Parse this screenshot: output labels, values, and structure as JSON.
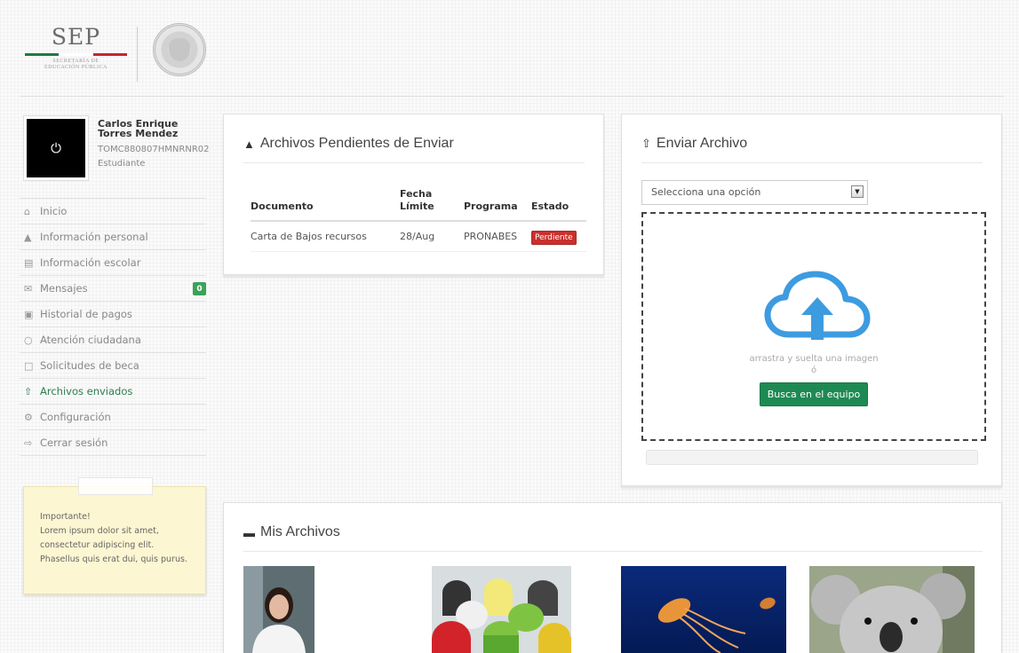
{
  "header": {
    "logo_text": "SEP",
    "logo_subtitle_1": "SECRETARÍA DE",
    "logo_subtitle_2": "EDUCACIÓN PÚBLICA",
    "logo_bar_colors": [
      "#1f7a3f",
      "#ffffff",
      "#c4262e"
    ]
  },
  "profile": {
    "name": "Carlos Enrique Torres Mendez",
    "id": "TOMC880807HMNRNR02",
    "role": "Estudiante",
    "avatar_icon": "power-icon"
  },
  "nav": {
    "items": [
      {
        "label": "Inicio",
        "icon": "home-icon"
      },
      {
        "label": "Información personal",
        "icon": "user-icon"
      },
      {
        "label": "Información escolar",
        "icon": "book-icon"
      },
      {
        "label": "Mensajes",
        "icon": "envelope-icon",
        "badge": "0"
      },
      {
        "label": "Historial de pagos",
        "icon": "money-icon"
      },
      {
        "label": "Atención ciudadana",
        "icon": "comments-icon"
      },
      {
        "label": "Solicitudes de beca",
        "icon": "file-icon"
      },
      {
        "label": "Archivos enviados",
        "icon": "upload-icon",
        "active": true
      },
      {
        "label": "Configuración",
        "icon": "cogs-icon"
      },
      {
        "label": "Cerrar sesión",
        "icon": "sign-out-icon"
      }
    ],
    "active_color": "#2e7d4f",
    "badge_color": "#3aa35a"
  },
  "note": {
    "lines": [
      "Importante!",
      "Lorem ipsum dolor sit amet,",
      "consectetur adipiscing elit.",
      "Phasellus quis erat dui, quis purus."
    ]
  },
  "pending": {
    "title": "Archivos Pendientes de Enviar",
    "icon": "warning-icon",
    "columns": [
      "Documento",
      "Fecha Límite",
      "Programa",
      "Estado"
    ],
    "rows": [
      {
        "documento": "Carta de Bajos recursos",
        "fecha": "28/Aug",
        "programa": "PRONABES",
        "estado": "Perdiente"
      }
    ],
    "status_color": "#c9302c"
  },
  "upload": {
    "title": "Enviar Archivo",
    "icon": "upload-icon",
    "select_value": "Selecciona una opción",
    "drop_text": "arrastra y suelta una imagen",
    "or_text": "ó",
    "button_label": "Busca en el equipo",
    "button_color": "#1e8a53",
    "cloud_color": "#3d9be0",
    "progress": 0
  },
  "files": {
    "title": "Mis Archivos",
    "icon": "folder-open-icon"
  }
}
